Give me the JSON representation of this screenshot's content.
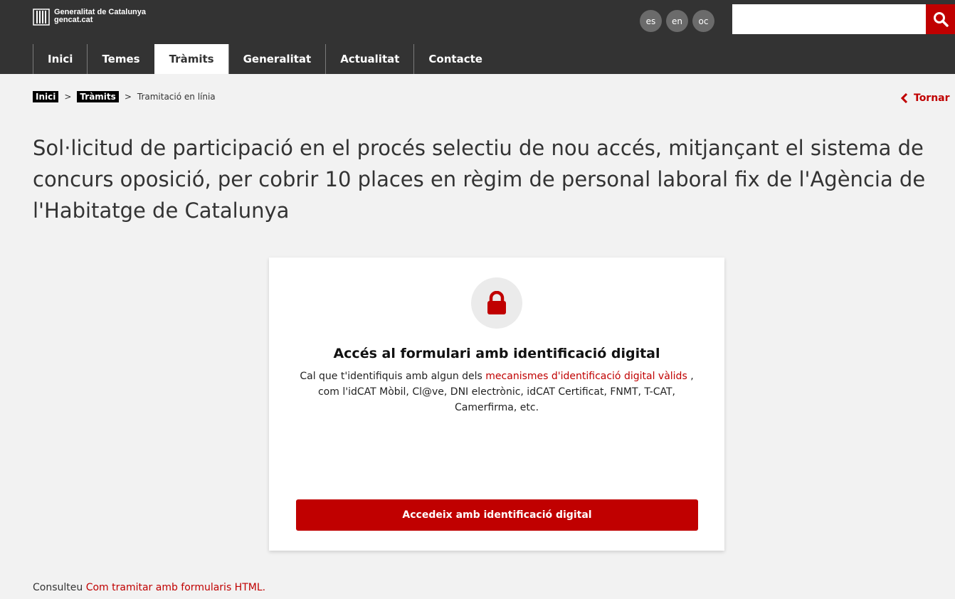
{
  "brand": {
    "line1": "Generalitat de Catalunya",
    "line2": "gencat.cat"
  },
  "languages": [
    "es",
    "en",
    "oc"
  ],
  "search": {
    "placeholder": "",
    "value": ""
  },
  "nav": {
    "items": [
      {
        "label": "Inici",
        "active": false
      },
      {
        "label": "Temes",
        "active": false
      },
      {
        "label": "Tràmits",
        "active": true
      },
      {
        "label": "Generalitat",
        "active": false
      },
      {
        "label": "Actualitat",
        "active": false
      },
      {
        "label": "Contacte",
        "active": false
      }
    ]
  },
  "breadcrumb": {
    "home": "Inici",
    "section": "Tràmits",
    "sep": ">",
    "current": "Tramitació en línia"
  },
  "back": {
    "label": "Tornar"
  },
  "page": {
    "title": "Sol·licitud de participació en el procés selectiu de nou accés, mitjançant el sistema de concurs oposició, per cobrir 10 places en règim de personal laboral fix de l'Agència de l'Habitatge de Catalunya"
  },
  "card": {
    "icon": "lock-icon",
    "title": "Accés al formulari amb identificació digital",
    "desc_before": "Cal que t'identifiquis amb algun dels ",
    "desc_link": "mecanismes d'identificació digital vàlids",
    "desc_after": " , com l'idCAT Mòbil, Cl@ve, DNI electrònic, idCAT Certificat, FNMT, T-CAT, Camerfirma, etc.",
    "button": "Accedeix amb identificació digital"
  },
  "footer": {
    "prefix": "Consulteu ",
    "link": "Com tramitar amb formularis HTML."
  },
  "colors": {
    "accent": "#c00000",
    "topbar": "#333333",
    "background": "#f2f2f2"
  }
}
